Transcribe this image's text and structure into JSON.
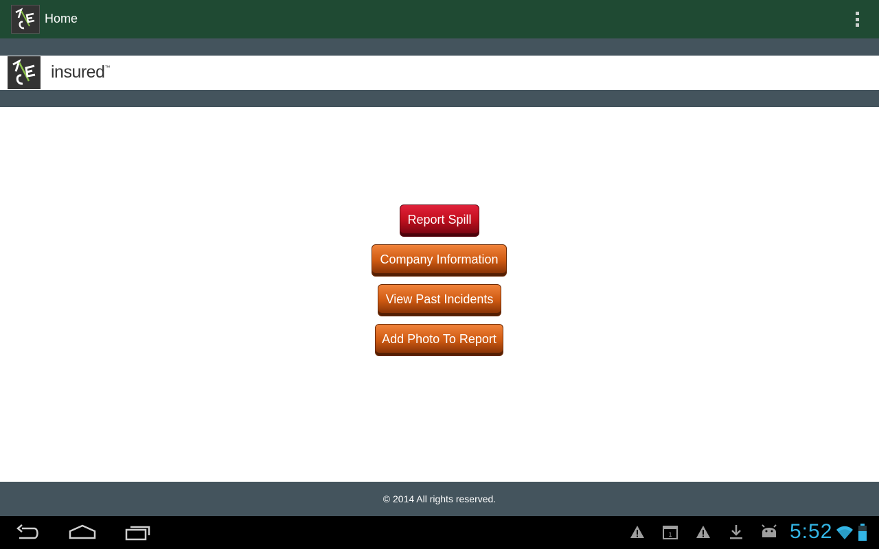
{
  "action_bar": {
    "title": "Home",
    "logo_icon": "ace-logo-icon",
    "overflow_icon": "overflow-menu-icon",
    "background": "#1f4a33"
  },
  "brand": {
    "logo_icon": "ace-logo-icon",
    "text": "insured",
    "tm": "™"
  },
  "buttons": {
    "report_spill": "Report Spill",
    "company_information": "Company Information",
    "view_past_incidents": "View Past Incidents",
    "add_photo_to_report": "Add Photo To Report"
  },
  "footer": {
    "copyright": "© 2014 All rights reserved."
  },
  "system_bar": {
    "nav_icons": [
      "back-icon",
      "home-icon",
      "recent-apps-icon"
    ],
    "status_icons": [
      "warning-icon",
      "calendar-icon",
      "warning-icon",
      "download-icon",
      "android-icon",
      "wifi-icon",
      "battery-icon"
    ],
    "time": "5:52",
    "time_color": "#33b5e5"
  },
  "colors": {
    "band": "#44545d",
    "red_button": "#c4101f",
    "orange_button": "#cf5a12"
  }
}
